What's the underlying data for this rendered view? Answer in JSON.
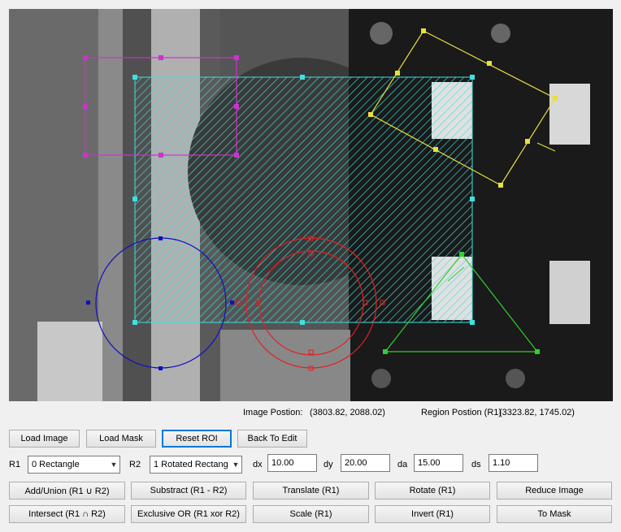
{
  "viewer": {
    "roi_colors": {
      "rectangle": "#40e0e0",
      "magenta": "#d030d0",
      "yellow": "#e8e040",
      "green": "#30d030",
      "red": "#e02020",
      "blue": "#1010c0"
    }
  },
  "status": {
    "image_position_label": "Image Postion:",
    "image_position_value": "(3803.82, 2088.02)",
    "region_position_label": "Region Postion (R1)",
    "region_position_value": "(3323.82, 1745.02)"
  },
  "toolbar": {
    "load_image": "Load Image",
    "load_mask": "Load Mask",
    "reset_roi": "Reset ROI",
    "back_to_edit": "Back To Edit"
  },
  "params": {
    "r1_label": "R1",
    "r1_value": "0 Rectangle",
    "r2_label": "R2",
    "r2_value": "1 Rotated Rectang",
    "dx_label": "dx",
    "dx_value": "10.00",
    "dy_label": "dy",
    "dy_value": "20.00",
    "da_label": "da",
    "da_value": "15.00",
    "ds_label": "ds",
    "ds_value": "1.10"
  },
  "ops": {
    "add_union": "Add/Union (R1 ∪ R2)",
    "subtract": "Substract (R1 - R2)",
    "translate": "Translate (R1)",
    "rotate": "Rotate (R1)",
    "reduce_image": "Reduce Image",
    "intersect": "Intersect (R1 ∩ R2)",
    "xor": "Exclusive OR (R1 xor R2)",
    "scale": "Scale (R1)",
    "invert": "Invert (R1)",
    "to_mask": "To Mask"
  }
}
